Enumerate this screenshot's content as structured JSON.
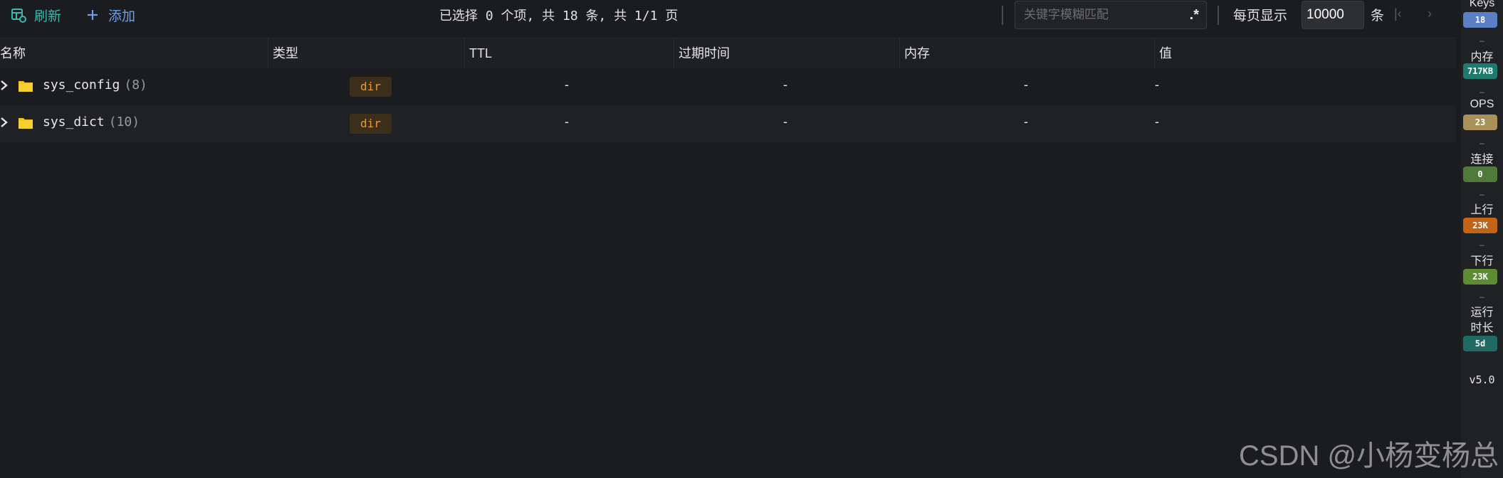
{
  "toolbar": {
    "refresh_label": "刷新",
    "add_label": "添加",
    "selection_status": "已选择 0 个项, 共 18 条, 共 1/1 页",
    "search_placeholder": "关键字模糊匹配",
    "regex_glyph": ".*",
    "per_page_label": "每页显示",
    "per_page_value": "10000",
    "per_page_unit": "条",
    "first_page_glyph": "|‹",
    "next_page_glyph": "›"
  },
  "table": {
    "columns": [
      "名称",
      "类型",
      "TTL",
      "过期时间",
      "内存",
      "值"
    ],
    "rows": [
      {
        "name": "sys_config",
        "count": "(8)",
        "type": "dir",
        "ttl": "-",
        "expire": "-",
        "memory": "-",
        "value": "-"
      },
      {
        "name": "sys_dict",
        "count": "(10)",
        "type": "dir",
        "ttl": "-",
        "expire": "-",
        "memory": "-",
        "value": "-"
      }
    ]
  },
  "stats": [
    {
      "label": "Keys",
      "value": "18",
      "color": "#5b7fc4"
    },
    {
      "label": "内存",
      "value": "717KB",
      "color": "#1f7a6e"
    },
    {
      "label": "OPS",
      "value": "23",
      "color": "#a8925a"
    },
    {
      "label": "连接",
      "value": "0",
      "color": "#4f7a3a"
    },
    {
      "label": "上行",
      "value": "23K",
      "color": "#c46314"
    },
    {
      "label": "下行",
      "value": "23K",
      "color": "#5e8c33"
    },
    {
      "label": "运行时长",
      "label_line1": "运行",
      "label_line2": "时长",
      "value": "5d",
      "color": "#1f6a63"
    }
  ],
  "stat_separator": "–",
  "version": "v5.0",
  "watermark": "CSDN @小杨变杨总",
  "colors": {
    "accent_teal": "#3fb6ad",
    "accent_blue": "#6f9ee8",
    "badge_dir_bg": "#3b2e1a",
    "badge_dir_text": "#e99a33",
    "folder": "#f5c523"
  },
  "icons": {
    "refresh": "refresh-table-icon",
    "add": "plus-icon",
    "row_expand": "chevron-right-icon",
    "row_folder": "folder-icon",
    "regex": "regex-icon"
  }
}
